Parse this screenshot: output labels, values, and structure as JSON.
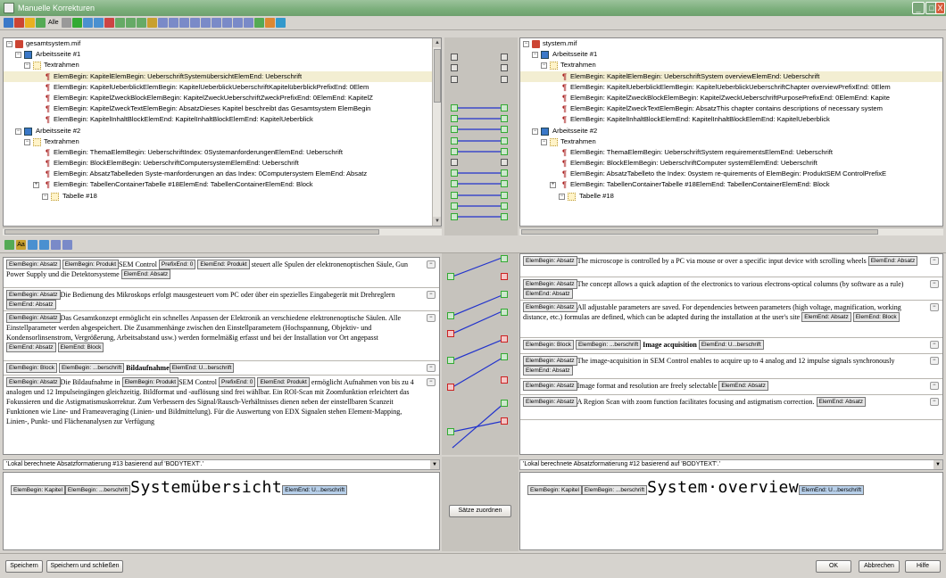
{
  "window": {
    "title": "Manuelle Korrekturen",
    "btn_min": "_",
    "btn_max": "□",
    "btn_close": "X"
  },
  "toolbar": {
    "alle_label": "Alle"
  },
  "left_tree": {
    "root": "gesamtsystem.mif",
    "page1": "Arbeitsseite #1",
    "textrahmen1": "Textrahmen",
    "items1": [
      "ElemBegin: KapitelElemBegin: UeberschriftSystemübersichtElemEnd: Ueberschrift",
      "ElemBegin: KapitelUeberblickElemBegin: KapitelUeberblickUeberschriftKapitelüberblickPrefixEnd: 0Elem",
      "ElemBegin: KapitelZweckBlockElemBegin: KapitelZweckUeberschriftZweckPrefixEnd: 0ElemEnd: KapitelZ",
      "ElemBegin: KapitelZweckTextElemBegin: AbsatzDieses Kapitel beschreibt das Gesamtsystem ElemBegin",
      "ElemBegin: KapitelInhaltBlockElemEnd: KapitelInhaltBlockElemEnd: KapitelUeberblick"
    ],
    "page2": "Arbeitsseite #2",
    "textrahmen2": "Textrahmen",
    "items2": [
      "ElemBegin: ThemaElemBegin: UeberschriftIndex: 0SystemanforderungenElemEnd: Ueberschrift",
      "ElemBegin: BlockElemBegin: UeberschriftComputersystemElemEnd: Ueberschrift",
      "ElemBegin: AbsatzTabelleden Syste-manforderungen an das Index: 0Computersystem ElemEnd: Absatz",
      "ElemBegin: TabellenContainerTabelle #18ElemEnd: TabellenContainerElemEnd: Block"
    ],
    "tabelle": "Tabelle #18"
  },
  "right_tree": {
    "root": "stystem.mif",
    "page1": "Arbeitsseite #1",
    "textrahmen1": "Textrahmen",
    "items1": [
      "ElemBegin: KapitelElemBegin: UeberschriftSystem overviewElemEnd: Ueberschrift",
      "ElemBegin: KapitelUeberblickElemBegin: KapitelUeberblickUeberschriftChapter overviewPrefixEnd: 0Elem",
      "ElemBegin: KapitelZweckBlockElemBegin: KapitelZweckUeberschriftPurposePrefixEnd: 0ElemEnd: Kapite",
      "ElemBegin: KapitelZweckTextElemBegin: AbsatzThis chapter contains descriptions of necessary system",
      "ElemBegin: KapitelInhaltBlockElemEnd: KapitelInhaltBlockElemEnd: KapitelUeberblick"
    ],
    "page2": "Arbeitsseite #2",
    "textrahmen2": "Textrahmen",
    "items2": [
      "ElemBegin: ThemaElemBegin: UeberschriftSystem requirementsElemEnd: Ueberschrift",
      "ElemBegin: BlockElemBegin: UeberschriftComputer systemElemEnd: Ueberschrift",
      "ElemBegin: AbsatzTabelleto the Index: 0system re-quirements of ElemBegin: ProduktSEM ControlPrefixE",
      "ElemBegin: TabellenContainerTabelle #18ElemEnd: TabellenContainerElemEnd: Block"
    ],
    "tabelle": "Tabelle #18"
  },
  "tags": {
    "absatz": "ElemBegin: Absatz",
    "produkt": "ElemBegin: Produkt",
    "prefix": "PrefixEnd: 0",
    "end_produkt": "ElemEnd: Produkt",
    "end_absatz": "ElemEnd: Absatz",
    "end_block": "ElemEnd: Block",
    "block": "ElemBegin: Block",
    "uberschrift": "ElemBegin: ...berschrift",
    "end_uberschrift": "ElemEnd: U...berschrift",
    "kapitel": "ElemBegin: Kapitel"
  },
  "left_paras": {
    "p1a": "SEM Control",
    "p1b": "steuert alle Spulen der elektronenoptischen Säule, Gun Power Supply und die Detektorsysteme",
    "p2": "Die Bedienung des Mikroskops erfolgt mausgesteuert vom PC oder über ein spezielles Eingabegerät mit Drehreglern",
    "p3": "Das Gesamtkonzept ermöglicht ein schnelles Anpassen der Elektronik an verschiedene elektronenoptische Säulen. Alle Einstellparameter werden abgespeichert. Die Zusammenhänge zwischen den Einstellparametern (Hochspannung, Objektiv- und Kondensorlinsenstrom, Vergrößerung, Arbeitsabstand usw.) werden formelmäßig erfasst und bei der Installation vor Ort angepasst",
    "p4": "Bildaufnahme",
    "p5a": "Die Bildaufnahme in",
    "p5b": "SEM Control",
    "p5c": "ermöglicht Aufnahmen von bis zu 4 analogen und 12 Impulseingängen gleichzeitig. Bildformat und -auflösung sind frei wählbar. Ein ROI-Scan mit Zoomfunktion erleichtert das Fokussieren und die Astigmatismuskorrektur. Zum Verbessern des Signal/Rausch-Verhältnisses dienen neben der einstellbaren Scanzeit Funktionen wie Line- und Frameaveraging (Linien- und Bildmittelung). Für die Auswertung von EDX Signalen stehen Element-Mapping, Linien-, Punkt- und Flächenanalysen zur Verfügung"
  },
  "right_paras": {
    "p1": "The microscope is controlled by a PC via mouse or over a specific input device with scrolling wheels",
    "p2": "The concept allows a quick adaption of the electronics to various electrons-optical columns (by software as a rule)",
    "p3": "All adjustable parameters are saved. For dependencies between parameters (high voltage, magnification, working distance, etc.) formulas are defined, which can be adapted during the installation at the user's site",
    "p4": "Image acquisition",
    "p5": "The image-acquisition in SEM Control enables to acquire up to 4 analog and 12 impulse signals synchronously",
    "p6": "Image format and resolution are freely selectable",
    "p7": "A Region Scan with zoom function facilitates focusing and astigmatism correction."
  },
  "editor": {
    "left_format": "'Lokal berechnete Absatzformatierung #13 basierend auf 'BODYTEXT'.'",
    "right_format": "'Lokal berechnete Absatzformatierung #12 basierend auf 'BODYTEXT'.'",
    "left_big": "Systemübersicht",
    "right_big": "System·overview",
    "assign_button": "Sätze zuordnen"
  },
  "buttons": {
    "save": "Speichern",
    "save_close": "Speichern und schließen",
    "ok": "OK",
    "cancel": "Abbrechen",
    "help": "Hilfe"
  },
  "colors": {
    "title_green": "#7aae7a",
    "link_blue": "#2233cc",
    "match_green": "#33aa33",
    "mismatch_red": "#cc2222",
    "selection": "#b7cfe9"
  }
}
